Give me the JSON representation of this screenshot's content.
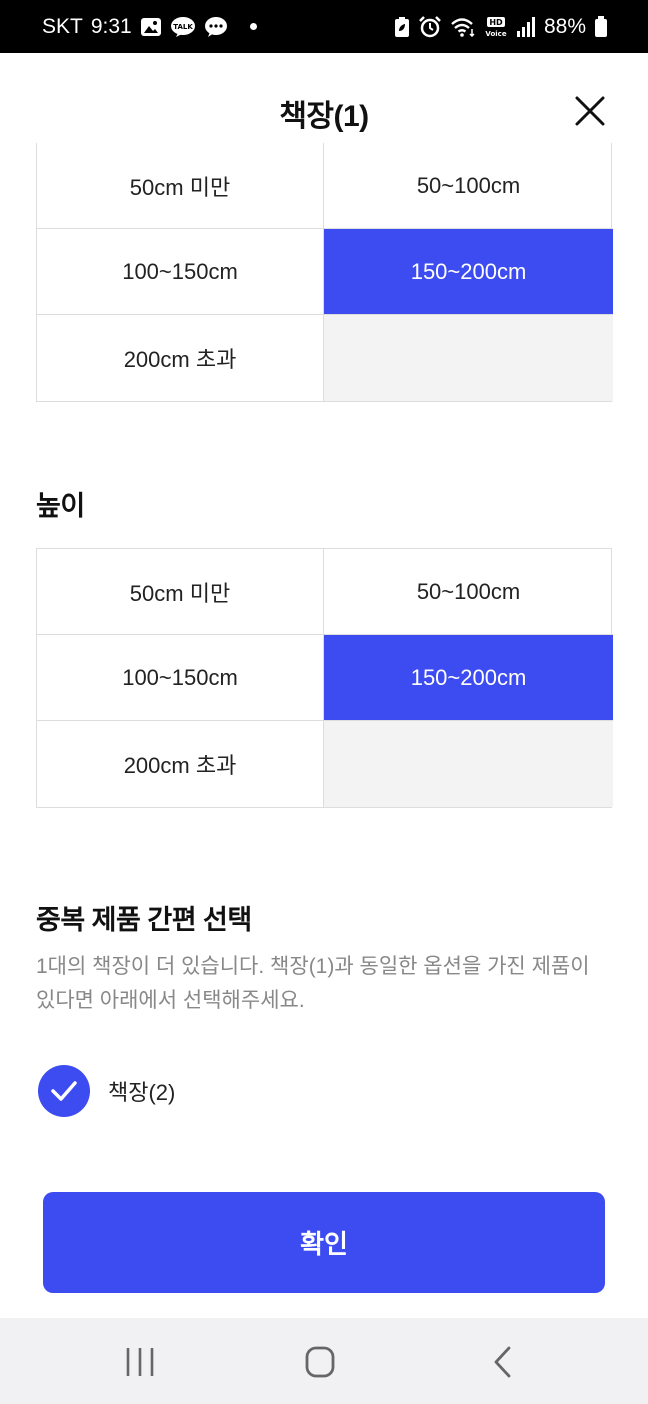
{
  "status_bar": {
    "carrier": "SKT",
    "time": "9:31",
    "battery": "88%",
    "left_icons": [
      "gallery-icon",
      "kakaotalk-icon",
      "message-icon"
    ],
    "right_icons": [
      "battery-saver-icon",
      "alarm-icon",
      "wifi-icon",
      "hd-voice-icon",
      "signal-icon",
      "battery-icon"
    ]
  },
  "header": {
    "title": "책장(1)",
    "close_icon": "close-icon"
  },
  "width_section": {
    "options": [
      "50cm 미만",
      "50~100cm",
      "100~150cm",
      "150~200cm",
      "200cm 초과",
      ""
    ],
    "selected": "150~200cm"
  },
  "height_section": {
    "title": "높이",
    "options": [
      "50cm 미만",
      "50~100cm",
      "100~150cm",
      "150~200cm",
      "200cm 초과",
      ""
    ],
    "selected": "150~200cm"
  },
  "duplicate_section": {
    "title": "중복 제품 간편 선택",
    "description": "1대의 책장이 더 있습니다. 책장(1)과 동일한 옵션을 가진 제품이 있다면 아래에서 선택해주세요.",
    "items": [
      {
        "label": "책장(2)",
        "checked": true
      }
    ]
  },
  "confirm_button": {
    "label": "확인"
  },
  "nav_bar": {
    "icons": [
      "recent-apps-icon",
      "home-icon",
      "back-icon"
    ]
  },
  "colors": {
    "accent": "#3d4cf0",
    "empty_cell": "#f3f3f3",
    "muted_text": "#888888"
  }
}
